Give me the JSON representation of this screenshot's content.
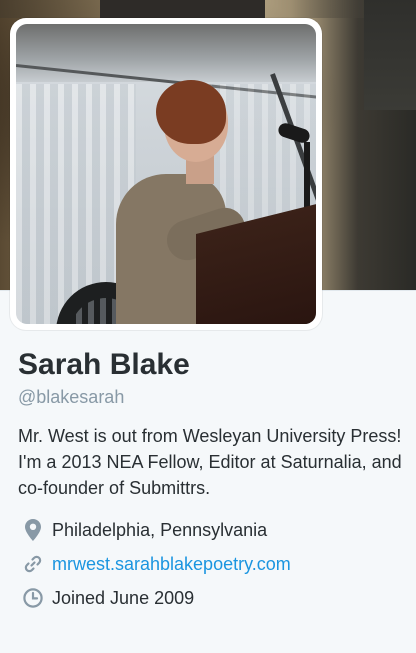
{
  "profile": {
    "name": "Sarah Blake",
    "handle": "@blakesarah",
    "bio": "Mr. West is out from Wesleyan University Press! I'm a 2013 NEA Fellow, Editor at Saturnalia, and co-founder of Submittrs.",
    "location": "Philadelphia, Pennsylvania",
    "website": "mrwest.sarahblakepoetry.com",
    "joined": "Joined June 2009"
  },
  "icons": {
    "location": "location-pin-icon",
    "website": "link-icon",
    "joined": "clock-icon"
  },
  "colors": {
    "name": "#292f33",
    "handle": "#8899a6",
    "link": "#1b95e0",
    "icon": "#8899a6",
    "background": "#f5f8fa"
  }
}
